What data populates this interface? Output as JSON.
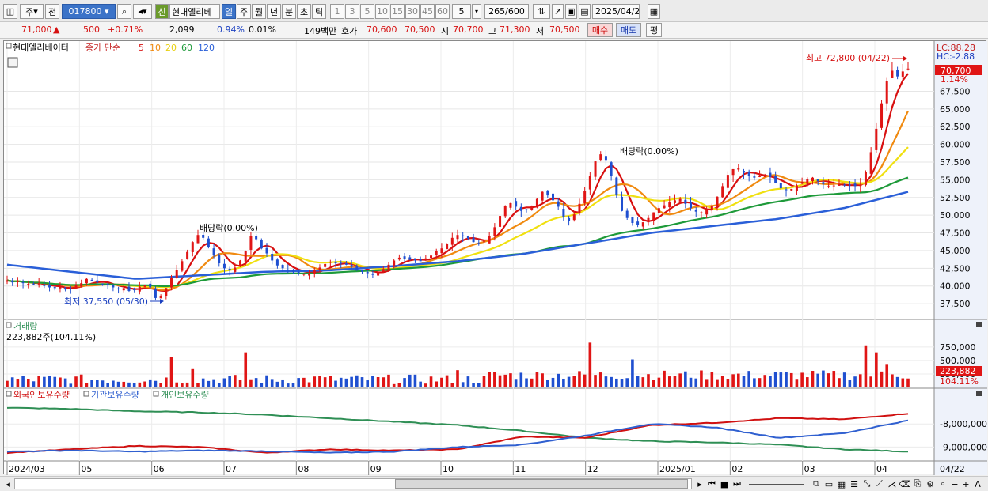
{
  "toolbar": {
    "market": "주",
    "scope": "전",
    "code": "017800",
    "new_badge": "신",
    "stock_name": "현대엘리베",
    "periods": [
      "일",
      "주",
      "월",
      "년",
      "분",
      "초",
      "틱"
    ],
    "active_period": "일",
    "minutes": [
      "1",
      "3",
      "5",
      "10",
      "15",
      "30",
      "45",
      "60"
    ],
    "interval": "5",
    "count": "265/600",
    "date": "2025/04/22"
  },
  "quote": {
    "price": "71,000",
    "change_arrow": "▲",
    "change": "500",
    "change_pct": "+0.71%",
    "volume": "2,099",
    "vol_ratio": "0.94%",
    "turnover_pct": "0.01%",
    "amount": "149백만",
    "bid_label": "호가",
    "bid_value": "70,600",
    "ask_value": "70,500",
    "open_label": "시",
    "open": "70,700",
    "high_label": "고",
    "high": "71,300",
    "low_label": "저",
    "low": "70,500",
    "buy": "매수",
    "sell": "매도",
    "even": "평"
  },
  "main": {
    "title": "현대엘리베이터",
    "ma_label": "종가 단순",
    "ma_periods": [
      "5",
      "10",
      "20",
      "60",
      "120"
    ],
    "ma_colors": [
      "#d81010",
      "#f08a10",
      "#f0e010",
      "#1e9a3a",
      "#2a5fd8"
    ],
    "lc": "LC:88.28",
    "hc": "HC:-2.88",
    "last_price": "70,700",
    "last_pct": "1.14%",
    "high_note": "최고 72,800 (04/22)",
    "low_note": "최저 37,550 (05/30)",
    "div1": "배당락(0.00%)",
    "div2": "배당락(0.00%)",
    "price_ticks": [
      "67,500",
      "65,000",
      "62,500",
      "60,000",
      "57,500",
      "55,000",
      "52,500",
      "50,000",
      "47,500",
      "45,000",
      "42,500",
      "40,000",
      "37,500"
    ]
  },
  "volume": {
    "title": "거래량",
    "info": "223,882주(104.11%)",
    "ticks": [
      "750,000",
      "500,000",
      "250,000"
    ],
    "last": "223,882",
    "last_pct": "104.11%",
    "up_color": "#e01515",
    "down_color": "#1f4fd0"
  },
  "holdings": {
    "labels": [
      "외국인보유수량",
      "기관보유수량",
      "개인보유수량"
    ],
    "colors": [
      "#d01010",
      "#3060d0",
      "#2f8f55"
    ],
    "ticks": [
      "-8,000,000",
      "-9,000,000"
    ]
  },
  "x_labels": [
    "2024/03",
    "05",
    "06",
    "07",
    "08",
    "09",
    "10",
    "11",
    "12",
    "2025/01",
    "02",
    "03",
    "04"
  ],
  "x_right": "04/22",
  "chart_data": {
    "type": "candlestick",
    "x_start": "2024/03",
    "x_end": "2025/04/22",
    "ylim": [
      35500,
      70900
    ],
    "closes": [
      40800,
      40500,
      40700,
      40400,
      40300,
      40200,
      40400,
      40000,
      39800,
      39700,
      39900,
      39500,
      39600,
      40100,
      40400,
      41000,
      40700,
      40500,
      40300,
      40100,
      39800,
      39600,
      39700,
      39300,
      39400,
      39900,
      40100,
      39800,
      38300,
      38600,
      39700,
      41200,
      42300,
      43500,
      44800,
      46200,
      47200,
      46800,
      45500,
      44300,
      43200,
      42500,
      42200,
      42600,
      43600,
      44900,
      47100,
      46600,
      45300,
      44600,
      43600,
      42900,
      42500,
      42300,
      42000,
      41900,
      41700,
      41700,
      42200,
      42600,
      43100,
      43400,
      43300,
      43200,
      43000,
      42700,
      42300,
      42000,
      41800,
      41600,
      41900,
      42400,
      43000,
      43600,
      44000,
      43800,
      43700,
      43600,
      43500,
      43900,
      44300,
      44900,
      45300,
      45900,
      46800,
      47200,
      47000,
      46700,
      46200,
      46000,
      46300,
      47100,
      48300,
      49900,
      51300,
      51700,
      51200,
      50600,
      50700,
      51300,
      52300,
      53300,
      52800,
      52100,
      51200,
      49800,
      49200,
      50100,
      51600,
      53400,
      55600,
      57600,
      58600,
      57800,
      55600,
      52900,
      50600,
      49600,
      48900,
      48600,
      49000,
      49600,
      50400,
      51000,
      51400,
      51800,
      52100,
      52300,
      51600,
      51000,
      50500,
      50400,
      50700,
      51300,
      52600,
      54100,
      55700,
      56500,
      56600,
      56000,
      55500,
      55300,
      55500,
      55700,
      55400,
      54500,
      53800,
      53600,
      53700,
      54200,
      54700,
      55100,
      55300,
      54800,
      54400,
      54100,
      54200,
      54400,
      54300,
      54200,
      54100,
      54300,
      56100,
      58900,
      62200,
      65800,
      69000,
      70400,
      69600,
      70300,
      70700
    ],
    "ma120_anchor": [
      43000,
      42000,
      41000,
      41500,
      42000,
      42200,
      42800,
      43500,
      44500,
      46000,
      47500,
      48500,
      49500,
      51000,
      53300
    ],
    "volume_scale": [
      0,
      850000
    ],
    "holdings_ylim": [
      -9500000,
      -7000000
    ]
  }
}
